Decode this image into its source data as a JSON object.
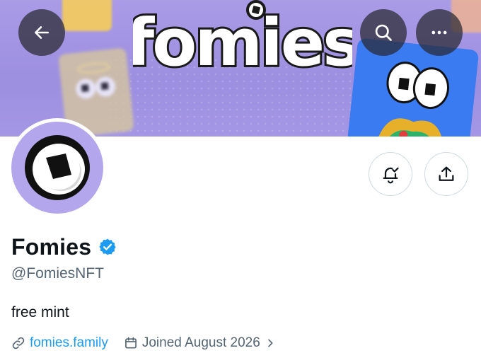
{
  "header": {
    "banner_text": "fomies",
    "back_icon": "arrow-left-icon",
    "search_icon": "search-icon",
    "more_icon": "more-horizontal-icon"
  },
  "profile": {
    "display_name": "Fomies",
    "verified_icon": "verified-badge-icon",
    "handle": "@FomiesNFT",
    "bio": "free mint",
    "website": "fomies.family",
    "joined": "Joined August 2026"
  },
  "actions": {
    "notify_icon": "bell-check-icon",
    "share_icon": "share-icon"
  },
  "colors": {
    "banner_purple": "#a99be6",
    "avatar_purple": "#b4a6ec",
    "link_blue": "#1d9bf0",
    "verified_blue": "#1d9bf0",
    "secondary_text": "#536471",
    "primary_text": "#0f1419"
  }
}
